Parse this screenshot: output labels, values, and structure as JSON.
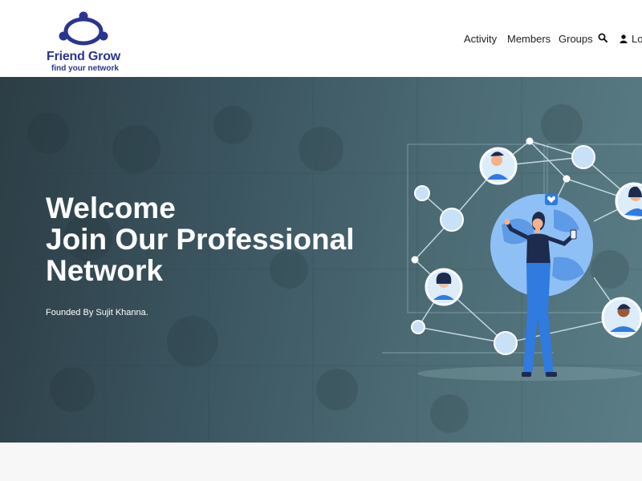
{
  "header": {
    "logo": {
      "name": "Friend Grow",
      "tagline": "find your network",
      "icon": "people-circle-logo-icon"
    },
    "nav": {
      "items": [
        "Activity",
        "Members",
        "Groups"
      ],
      "search_icon": "search-icon",
      "login_label": "Log",
      "login_icon": "user-icon"
    }
  },
  "hero": {
    "title_lines": [
      "Welcome",
      "Join Our Professional",
      "Network"
    ],
    "founded": "Founded By Sujit Khanna.",
    "illustration": "network-globe-woman-illustration"
  },
  "colors": {
    "brand": "#2a3591",
    "hero_bg": "#3b5560",
    "accent_blue": "#2f7be0",
    "globe_blue": "#8fc0f5"
  }
}
